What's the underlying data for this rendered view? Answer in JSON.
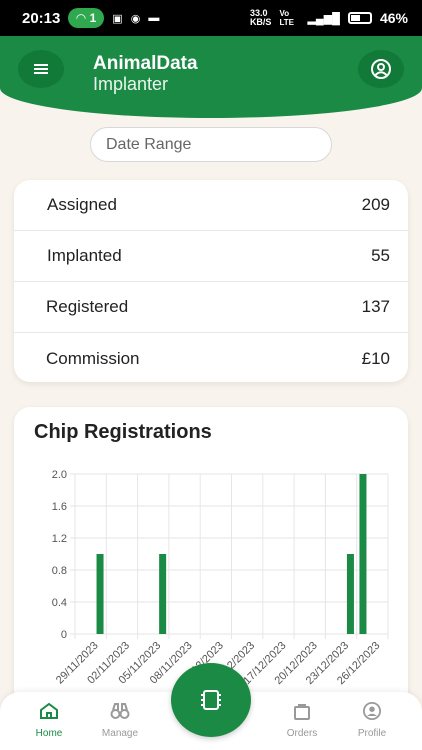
{
  "status_bar": {
    "time": "20:13",
    "hotspot_count": "1",
    "speed": "33.0",
    "speed_unit": "KB/S",
    "network_label": "Vo LTE",
    "battery_percent": "46%"
  },
  "header": {
    "brand_primary": "AnimalData",
    "brand_secondary": "Implanter"
  },
  "filter": {
    "date_range_placeholder": "Date Range"
  },
  "stats": [
    {
      "label": "Assigned",
      "value": "209"
    },
    {
      "label": "Implanted",
      "value": "55"
    },
    {
      "label": "Registered",
      "value": "137"
    },
    {
      "label": "Commission",
      "value": "£10"
    }
  ],
  "chart_title": "Chip Registrations",
  "chart_data": {
    "type": "bar",
    "title": "Chip Registrations",
    "xlabel": "",
    "ylabel": "",
    "ylim": [
      0,
      2.0
    ],
    "y_ticks": [
      "0",
      "0.4",
      "0.8",
      "1.2",
      "1.6",
      "2.0"
    ],
    "tick_labels": [
      "29/11/2023",
      "02/11/2023",
      "05/11/2023",
      "08/11/2023",
      "11/12/2023",
      "14/12/2023",
      "17/12/2023",
      "20/12/2023",
      "23/12/2023",
      "26/12/2023"
    ],
    "bars": [
      {
        "x_index": 0.8,
        "value": 1
      },
      {
        "x_index": 2.8,
        "value": 1
      },
      {
        "x_index": 8.8,
        "value": 1
      },
      {
        "x_index": 9.2,
        "value": 2
      }
    ],
    "grid": true,
    "bar_color": "#1a8a44"
  },
  "nav": {
    "home": "Home",
    "manage": "Manage",
    "orders": "Orders",
    "profile": "Profile"
  },
  "colors": {
    "brand": "#1a8a44",
    "background": "#f8f3ec"
  }
}
